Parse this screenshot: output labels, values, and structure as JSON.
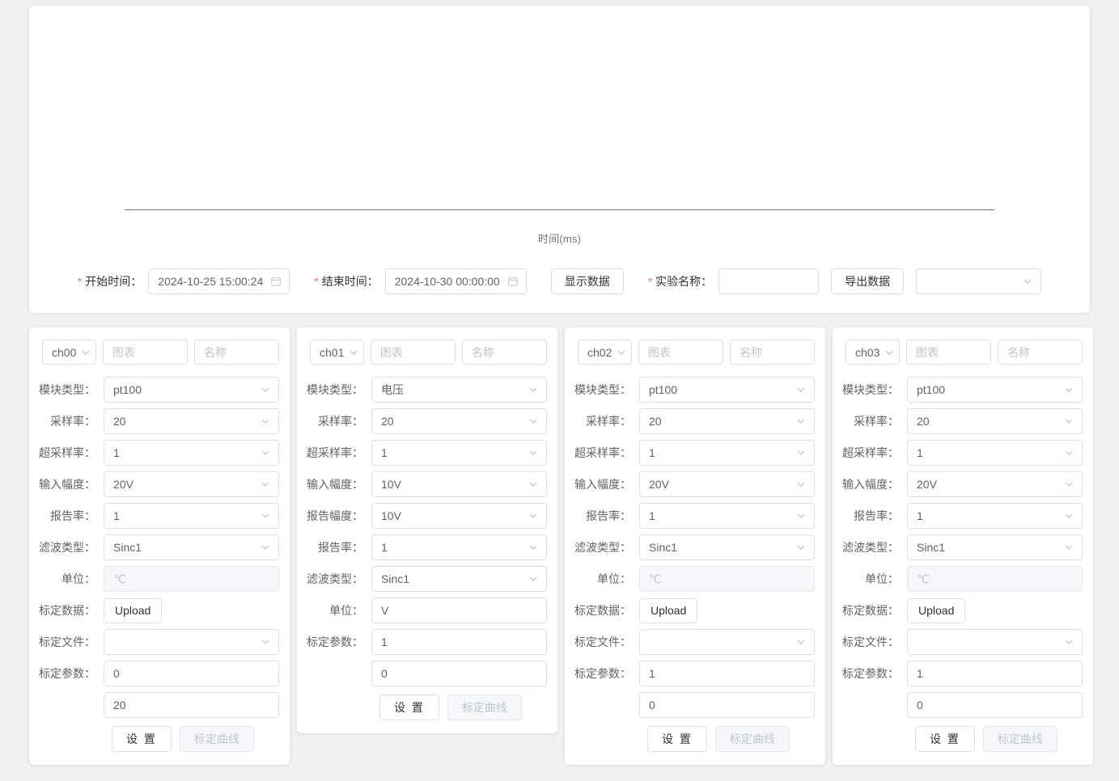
{
  "chart": {
    "xlabel": "时间(ms)"
  },
  "toolbar": {
    "start_time_label": "开始时间：",
    "start_time_value": "2024-10-25 15:00:24",
    "end_time_label": "结束时间：",
    "end_time_value": "2024-10-30 00:00:00",
    "show_data_button": "显示数据",
    "experiment_name_label": "实验名称：",
    "experiment_name_value": "",
    "experiment_name_placeholder": "",
    "export_data_button": "导出数据",
    "export_select_value": "",
    "required_mark": "*",
    "calendar_icon": "calendar-icon",
    "chevron_icon": "chevron-down-icon"
  },
  "labels": {
    "module_type": "模块类型：",
    "sample_rate": "采样率：",
    "over_sample_rate": "超采样率：",
    "input_amplitude": "输入幅度：",
    "report_amplitude": "报告幅度：",
    "report_rate": "报告率：",
    "filter_type": "滤波类型：",
    "unit": "单位：",
    "cal_data": "标定数据：",
    "cal_file": "标定文件：",
    "cal_param": "标定参数：",
    "chart_placeholder": "图表",
    "name_placeholder": "名称",
    "upload": "Upload",
    "set_button": "设 置",
    "cal_curve_button": "标定曲线"
  },
  "channels": [
    {
      "id": "ch00",
      "chart_value": "",
      "name_value": "",
      "module_type": "pt100",
      "sample_rate": "20",
      "over_sample_rate": "1",
      "input_amplitude": "20V",
      "report_amplitude": null,
      "report_rate": "1",
      "filter_type": "Sinc1",
      "unit": "℃",
      "unit_disabled": true,
      "has_upload": true,
      "cal_file": "",
      "cal_param_1": "0",
      "cal_param_2": "20"
    },
    {
      "id": "ch01",
      "chart_value": "",
      "name_value": "",
      "module_type": "电压",
      "sample_rate": "20",
      "over_sample_rate": "1",
      "input_amplitude": "10V",
      "report_amplitude": "10V",
      "report_rate": "1",
      "filter_type": "Sinc1",
      "unit": "V",
      "unit_disabled": false,
      "has_upload": false,
      "cal_file": null,
      "cal_param_1": "1",
      "cal_param_2": "0"
    },
    {
      "id": "ch02",
      "chart_value": "",
      "name_value": "",
      "module_type": "pt100",
      "sample_rate": "20",
      "over_sample_rate": "1",
      "input_amplitude": "20V",
      "report_amplitude": null,
      "report_rate": "1",
      "filter_type": "Sinc1",
      "unit": "℃",
      "unit_disabled": true,
      "has_upload": true,
      "cal_file": "",
      "cal_param_1": "1",
      "cal_param_2": "0"
    },
    {
      "id": "ch03",
      "chart_value": "",
      "name_value": "",
      "module_type": "pt100",
      "sample_rate": "20",
      "over_sample_rate": "1",
      "input_amplitude": "20V",
      "report_amplitude": null,
      "report_rate": "1",
      "filter_type": "Sinc1",
      "unit": "℃",
      "unit_disabled": true,
      "has_upload": true,
      "cal_file": "",
      "cal_param_1": "1",
      "cal_param_2": "0"
    }
  ],
  "colors": {
    "page_bg": "#f0f2f2",
    "card_bg": "#ffffff",
    "border": "#dcdfe6",
    "text": "#606266",
    "placeholder": "#c0c4cc",
    "required": "#f56c6c",
    "axis": "#6e7079"
  }
}
